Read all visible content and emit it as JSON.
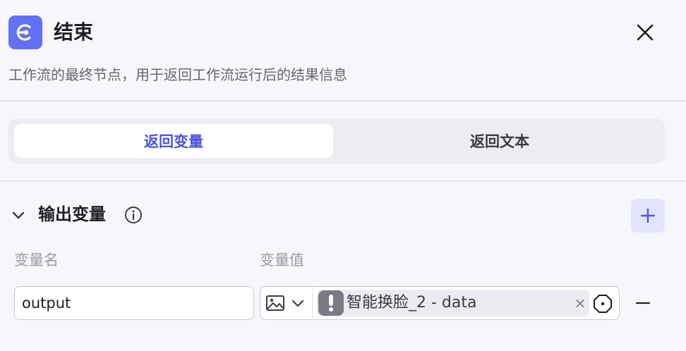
{
  "header": {
    "title": "结束",
    "description": "工作流的最终节点，用于返回工作流运行后的结果信息",
    "icon": "end-node-icon",
    "accent_color": "#6170f5"
  },
  "tabs": [
    {
      "label": "返回变量",
      "active": true
    },
    {
      "label": "返回文本",
      "active": false
    }
  ],
  "output_section": {
    "title": "输出变量",
    "columns": {
      "name": "变量名",
      "value": "变量值"
    },
    "rows": [
      {
        "name": "output",
        "type_icon": "image-icon",
        "reference": "智能换脸_2 - data",
        "warning": true
      }
    ]
  },
  "colors": {
    "primary": "#4d53e8",
    "add_button_bg": "#e3e5fb",
    "warning_badge": "#7b7b88"
  }
}
